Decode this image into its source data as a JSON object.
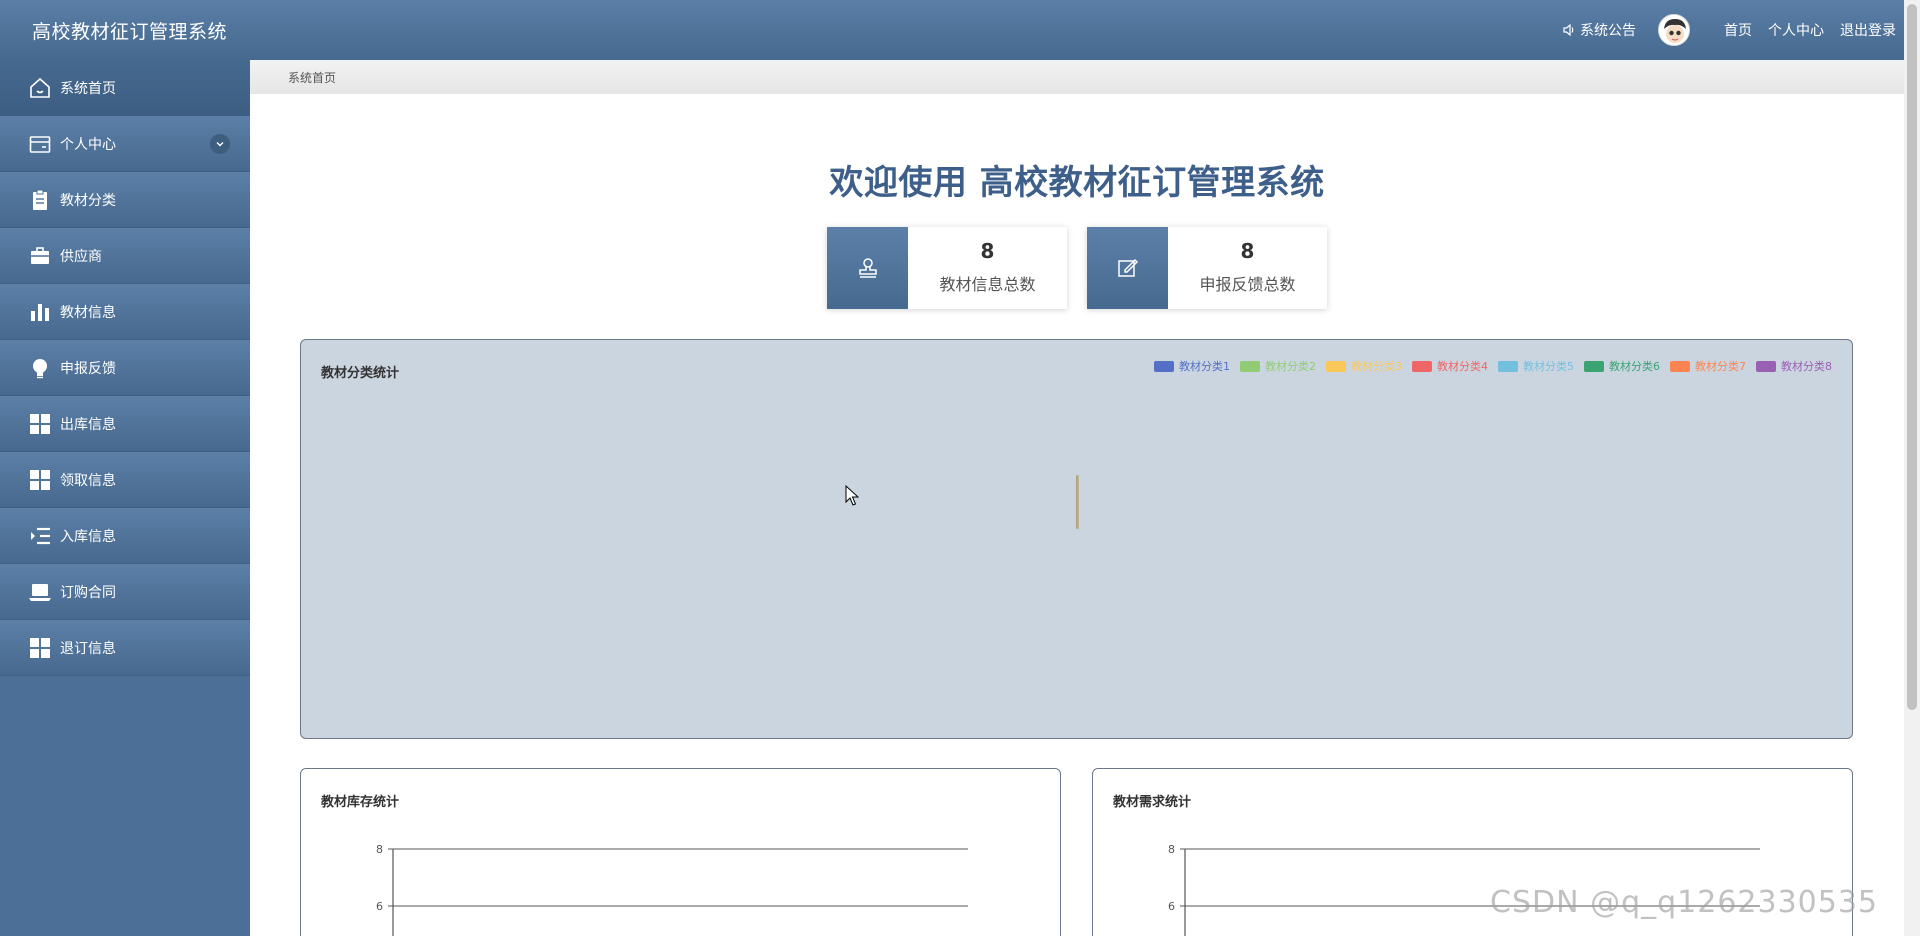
{
  "header": {
    "title": "高校教材征订管理系统",
    "notice": "系统公告",
    "links": [
      "首页",
      "个人中心",
      "退出登录"
    ]
  },
  "sidebar": {
    "items": [
      {
        "label": "系统首页",
        "icon": "home-icon"
      },
      {
        "label": "个人中心",
        "icon": "wallet-icon"
      },
      {
        "label": "教材分类",
        "icon": "clipboard-icon"
      },
      {
        "label": "供应商",
        "icon": "briefcase-icon"
      },
      {
        "label": "教材信息",
        "icon": "bar-chart-icon"
      },
      {
        "label": "申报反馈",
        "icon": "lightbulb-icon"
      },
      {
        "label": "出库信息",
        "icon": "grid-icon"
      },
      {
        "label": "领取信息",
        "icon": "grid-icon"
      },
      {
        "label": "入库信息",
        "icon": "indent-icon"
      },
      {
        "label": "订购合同",
        "icon": "laptop-icon"
      },
      {
        "label": "退订信息",
        "icon": "grid-icon"
      }
    ]
  },
  "breadcrumb": "系统首页",
  "welcome": "欢迎使用 高校教材征订管理系统",
  "stats": [
    {
      "value": "8",
      "label": "教材信息总数",
      "icon": "stamp-icon"
    },
    {
      "value": "8",
      "label": "申报反馈总数",
      "icon": "edit-icon"
    }
  ],
  "colors": {
    "accent": "#46698f",
    "legend": [
      "#5470c6",
      "#91cc75",
      "#fac858",
      "#ee6666",
      "#73c0de",
      "#3ba272",
      "#fc8452",
      "#9a60b4"
    ]
  },
  "chart_data": [
    {
      "type": "pie",
      "title": "教材分类统计",
      "legend": [
        "教材分类1",
        "教材分类2",
        "教材分类3",
        "教材分类4",
        "教材分类5",
        "教材分类6",
        "教材分类7",
        "教材分类8"
      ],
      "legend_position": "top-right"
    },
    {
      "type": "bar",
      "title": "教材库存统计",
      "y_ticks": [
        "8",
        "6"
      ],
      "ylim": [
        0,
        8
      ],
      "grid": true
    },
    {
      "type": "bar",
      "title": "教材需求统计",
      "y_ticks": [
        "8",
        "6"
      ],
      "ylim": [
        0,
        8
      ],
      "grid": true
    }
  ],
  "watermark": "CSDN @q_q1262330535"
}
